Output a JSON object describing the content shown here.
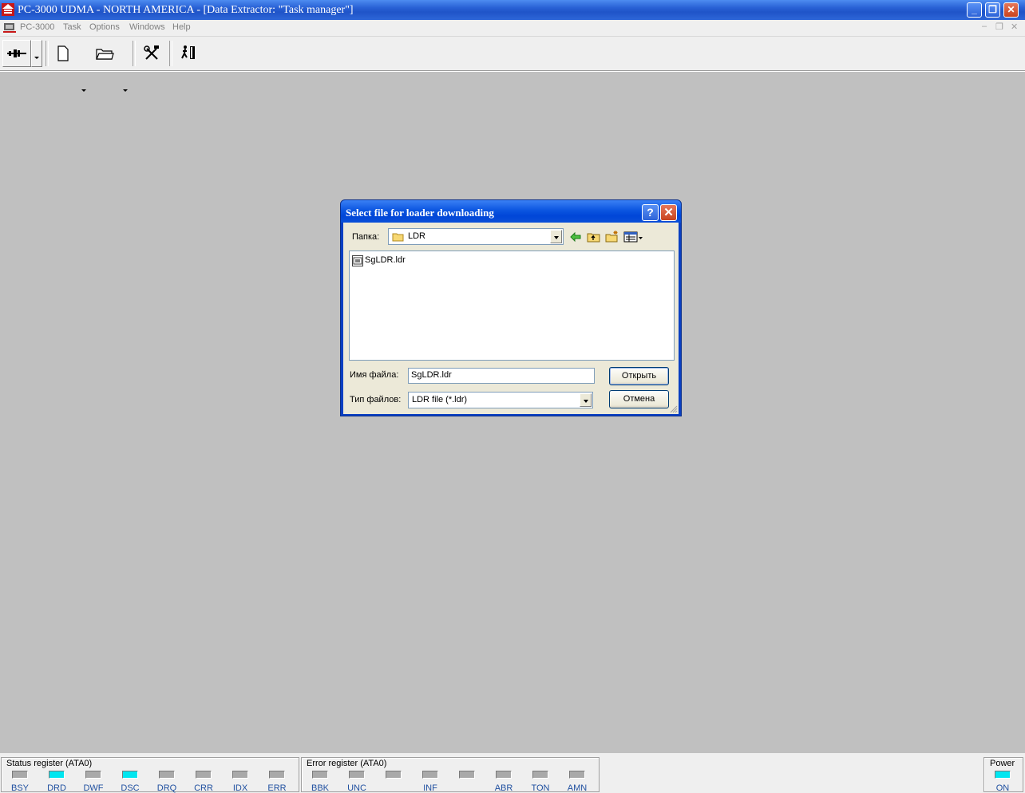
{
  "window": {
    "title": "PC-3000 UDMA - NORTH AMERICA - [Data Extractor: \"Task manager\"]",
    "controls": {
      "minimize": "_",
      "restore": "❐",
      "close": "✕"
    }
  },
  "menu": {
    "items": [
      "PC-3000",
      "Task",
      "Options",
      "Windows",
      "Help"
    ],
    "mdi_controls": [
      "–",
      "❐",
      "✕"
    ]
  },
  "toolbar": {
    "icons": [
      "connector-icon",
      "new-document-icon",
      "open-folder-icon",
      "tools-icon",
      "exit-icon"
    ]
  },
  "dialog": {
    "title": "Select file for loader downloading",
    "help_symbol": "?",
    "close_symbol": "✕",
    "folder_label": "Папка:",
    "folder_value": "LDR",
    "files": [
      {
        "name": "SgLDR.ldr",
        "icon": "ldr-file-icon"
      }
    ],
    "filename_label": "Имя файла:",
    "filename_value": "SgLDR.ldr",
    "filetype_label": "Тип файлов:",
    "filetype_value": "LDR file (*.ldr)",
    "open_label": "Открыть",
    "cancel_label": "Отмена"
  },
  "status": {
    "status_register": {
      "title": "Status register (ATA0)",
      "leds": [
        {
          "label": "BSY",
          "on": false
        },
        {
          "label": "DRD",
          "on": true
        },
        {
          "label": "DWF",
          "on": false
        },
        {
          "label": "DSC",
          "on": true
        },
        {
          "label": "DRQ",
          "on": false
        },
        {
          "label": "CRR",
          "on": false
        },
        {
          "label": "IDX",
          "on": false
        },
        {
          "label": "ERR",
          "on": false
        }
      ]
    },
    "error_register": {
      "title": "Error register (ATA0)",
      "leds": [
        {
          "label": "BBK",
          "on": false
        },
        {
          "label": "UNC",
          "on": false
        },
        {
          "label": "",
          "on": false
        },
        {
          "label": "INF",
          "on": false
        },
        {
          "label": "",
          "on": false
        },
        {
          "label": "ABR",
          "on": false
        },
        {
          "label": "TON",
          "on": false
        },
        {
          "label": "AMN",
          "on": false
        }
      ]
    },
    "power": {
      "title": "Power",
      "label": "ON",
      "on": true
    },
    "colors": {
      "led_on": "#00e6f0",
      "led_off": "#a9a9a9",
      "label_blue": "#2050a0"
    }
  }
}
